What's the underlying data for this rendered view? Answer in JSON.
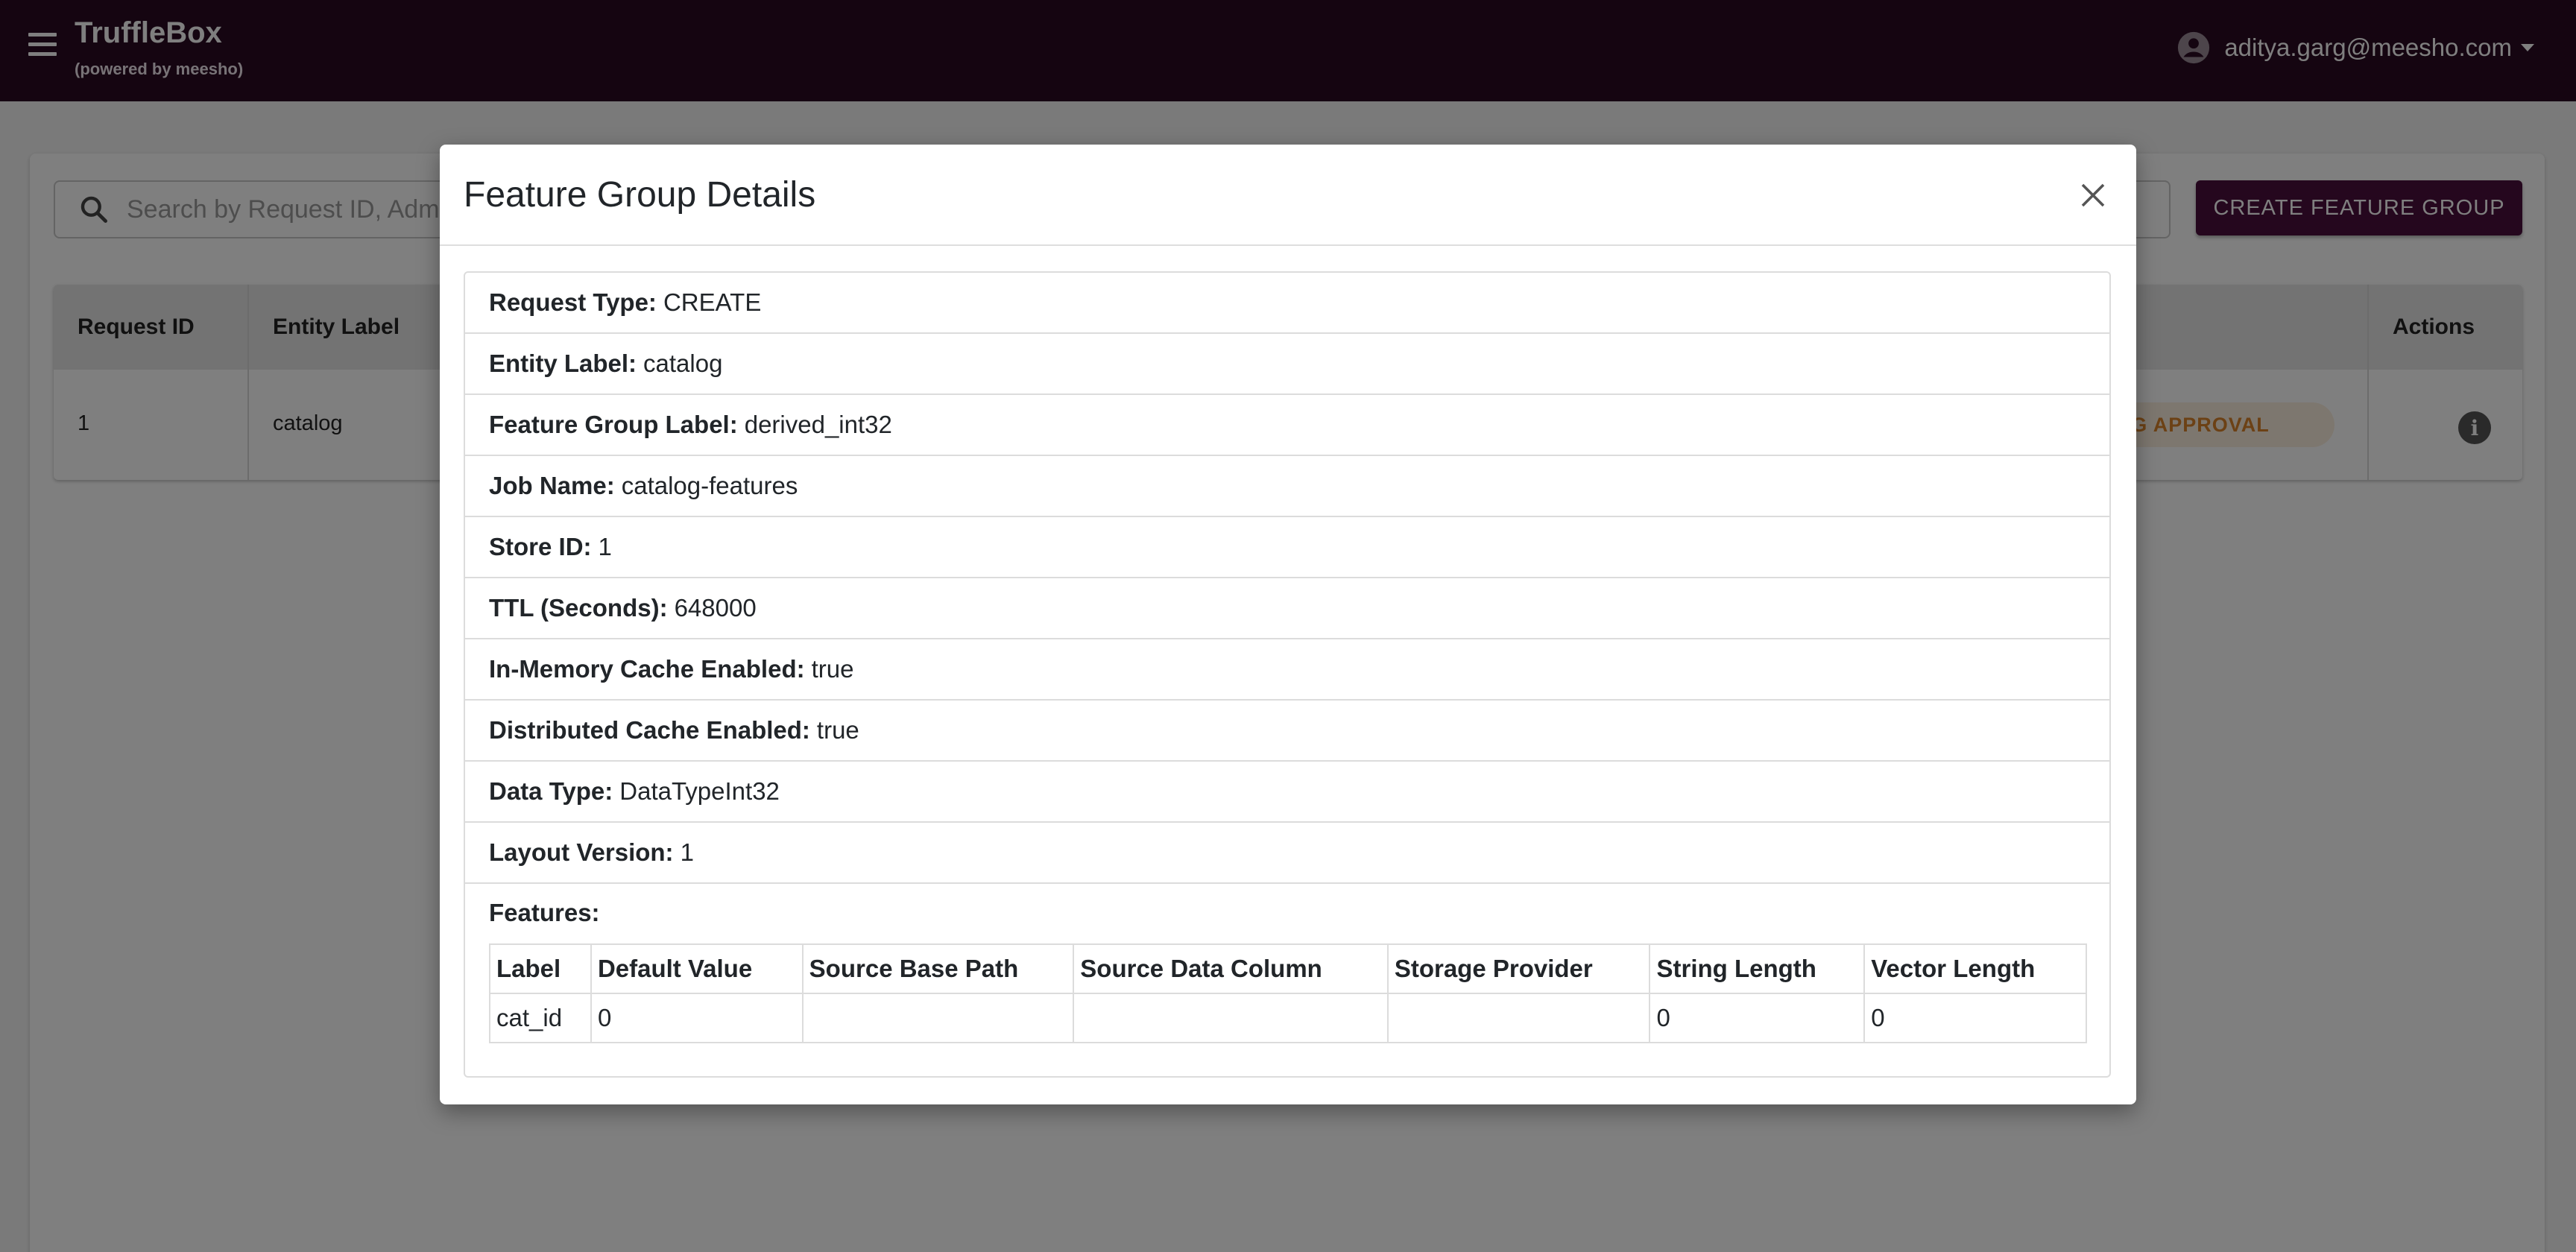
{
  "app": {
    "title": "TruffleBox",
    "subtitle": "(powered by meesho)",
    "user_email": "aditya.garg@meesho.com"
  },
  "toolbar": {
    "search_placeholder": "Search by Request ID, Admin",
    "create_button": "CREATE FEATURE GROUP"
  },
  "table": {
    "headers": {
      "request_id": "Request ID",
      "entity_label": "Entity Label",
      "actions": "Actions"
    },
    "rows": [
      {
        "request_id": "1",
        "entity_label": "catalog",
        "status": "G APPROVAL"
      }
    ]
  },
  "modal": {
    "title": "Feature Group Details",
    "details": [
      {
        "label": "Request Type:",
        "value": "CREATE"
      },
      {
        "label": "Entity Label:",
        "value": "catalog"
      },
      {
        "label": "Feature Group Label:",
        "value": "derived_int32"
      },
      {
        "label": "Job Name:",
        "value": "catalog-features"
      },
      {
        "label": "Store ID:",
        "value": "1"
      },
      {
        "label": "TTL (Seconds):",
        "value": "648000"
      },
      {
        "label": "In-Memory Cache Enabled:",
        "value": "true"
      },
      {
        "label": "Distributed Cache Enabled:",
        "value": "true"
      },
      {
        "label": "Data Type:",
        "value": "DataTypeInt32"
      },
      {
        "label": "Layout Version:",
        "value": "1"
      }
    ],
    "features_label": "Features:",
    "features_headers": [
      "Label",
      "Default Value",
      "Source Base Path",
      "Source Data Column",
      "Storage Provider",
      "String Length",
      "Vector Length"
    ],
    "features_rows": [
      [
        "cat_id",
        "0",
        "",
        "",
        "",
        "0",
        "0"
      ]
    ]
  },
  "colors": {
    "appbar": "#2a0a22",
    "primary_button": "#4a0f3c",
    "status_text": "#d9822b",
    "status_bg": "#fbeede"
  }
}
